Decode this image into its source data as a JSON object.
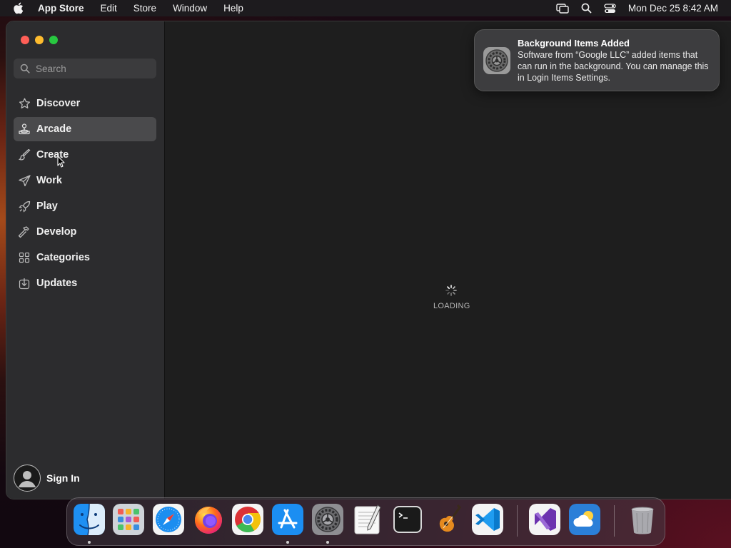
{
  "menubar": {
    "app_name": "App Store",
    "items": [
      "Edit",
      "Store",
      "Window",
      "Help"
    ],
    "clock": "Mon Dec 25  8:42 AM"
  },
  "sidebar": {
    "search_placeholder": "Search",
    "items": [
      {
        "label": "Discover",
        "icon": "star-icon"
      },
      {
        "label": "Arcade",
        "icon": "joystick-icon",
        "active": true
      },
      {
        "label": "Create",
        "icon": "paintbrush-icon"
      },
      {
        "label": "Work",
        "icon": "paperplane-icon"
      },
      {
        "label": "Play",
        "icon": "rocket-icon"
      },
      {
        "label": "Develop",
        "icon": "hammer-icon"
      },
      {
        "label": "Categories",
        "icon": "grid-icon"
      },
      {
        "label": "Updates",
        "icon": "download-icon"
      }
    ],
    "sign_in": "Sign In"
  },
  "main": {
    "loading_text": "LOADING"
  },
  "notification": {
    "title": "Background Items Added",
    "body": "Software from “Google LLC” added items that can run in the background. You can manage this in Login Items Settings.",
    "icon": "system-settings-icon"
  },
  "dock": {
    "apps": [
      {
        "name": "Finder",
        "icon": "finder-icon",
        "running": true
      },
      {
        "name": "Launchpad",
        "icon": "launchpad-icon"
      },
      {
        "name": "Safari",
        "icon": "safari-icon"
      },
      {
        "name": "Firefox",
        "icon": "firefox-icon"
      },
      {
        "name": "Google Chrome",
        "icon": "chrome-icon"
      },
      {
        "name": "App Store",
        "icon": "appstore-icon",
        "running": true
      },
      {
        "name": "System Settings",
        "icon": "system-settings-icon",
        "running": true
      },
      {
        "name": "TextEdit",
        "icon": "textedit-icon"
      },
      {
        "name": "Terminal",
        "icon": "terminal-icon"
      },
      {
        "name": "GarageBand",
        "icon": "garageband-icon"
      },
      {
        "name": "Visual Studio Code",
        "icon": "vscode-icon"
      },
      {
        "name": "Visual Studio",
        "icon": "visualstudio-icon"
      },
      {
        "name": "Weather",
        "icon": "weather-icon"
      },
      {
        "name": "Trash",
        "icon": "trash-icon"
      }
    ]
  }
}
